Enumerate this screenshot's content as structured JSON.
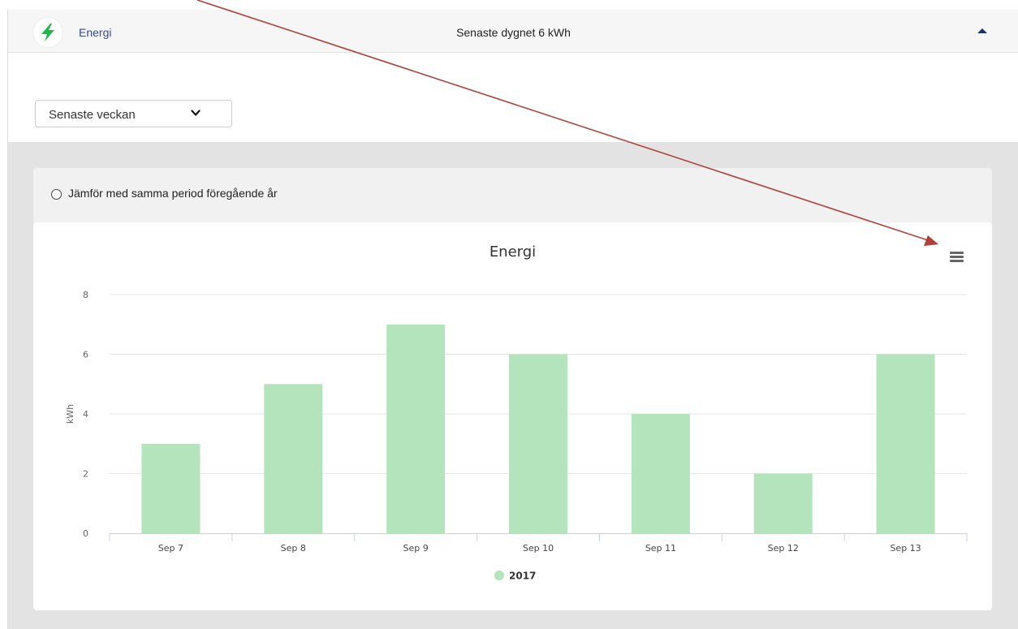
{
  "header": {
    "title": "Energi",
    "summary": "Senaste dygnet 6 kWh",
    "icon": "lightning-bolt-icon",
    "collapse_icon": "caret-up-icon"
  },
  "period_select": {
    "value": "Senaste veckan",
    "icon": "chevron-down-icon"
  },
  "compare": {
    "label": "Jämför med samma period föregående år",
    "checked": false
  },
  "chart_menu": {
    "icon": "hamburger-menu-icon"
  },
  "colors": {
    "bar": "#b3e4bb",
    "accent": "#3a4a8c",
    "bolt": "#1fb94a",
    "arrow": "#b0403a"
  },
  "chart_data": {
    "type": "bar",
    "title": "Energi",
    "xlabel": "",
    "ylabel": "kWh",
    "categories": [
      "Sep 7",
      "Sep 8",
      "Sep 9",
      "Sep 10",
      "Sep 11",
      "Sep 12",
      "Sep 13"
    ],
    "series": [
      {
        "name": "2017",
        "values": [
          3,
          5,
          7,
          6,
          4,
          2,
          6
        ]
      }
    ],
    "ylim": [
      0,
      8
    ],
    "yticks": [
      0,
      2,
      4,
      6,
      8
    ],
    "grid": true,
    "legend": "bottom-center"
  }
}
